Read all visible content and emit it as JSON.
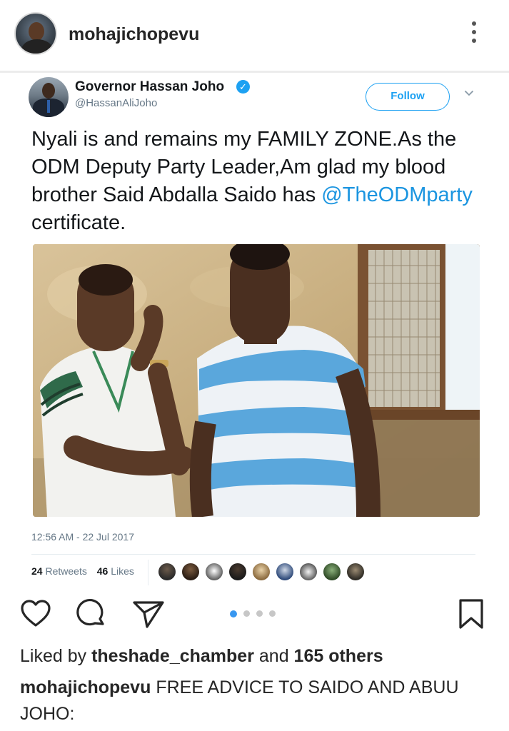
{
  "post": {
    "username": "mohajichopevu",
    "more_icon": "more-vertical-icon",
    "liked_by_prefix": "Liked by ",
    "liked_by_user": "theshade_chamber",
    "liked_by_and": " and ",
    "liked_by_others": "165 others",
    "caption_user": "mohajichopevu",
    "caption_text": " FREE ADVICE TO SAIDO AND ABUU JOHO:",
    "carousel": {
      "count": 4,
      "active_index": 0
    }
  },
  "tweet": {
    "name": "Governor Hassan Joho",
    "verified_icon": "verified-badge-icon",
    "handle": "@HassanAliJoho",
    "follow_label": "Follow",
    "text_before": "Nyali is and remains my FAMILY ZONE.As the ODM Deputy Party Leader,Am glad my blood brother Said Abdalla Saido has ",
    "mention": "@TheODMparty",
    "text_after": " certificate.",
    "timestamp": "12:56 AM - 22 Jul 2017",
    "retweets_count": "24",
    "retweets_label": "Retweets",
    "likes_count": "46",
    "likes_label": "Likes",
    "liker_count": 9
  },
  "colors": {
    "twitter_blue": "#1da1f2",
    "mention_blue": "#1b95e0",
    "carousel_active": "#3897f0"
  }
}
